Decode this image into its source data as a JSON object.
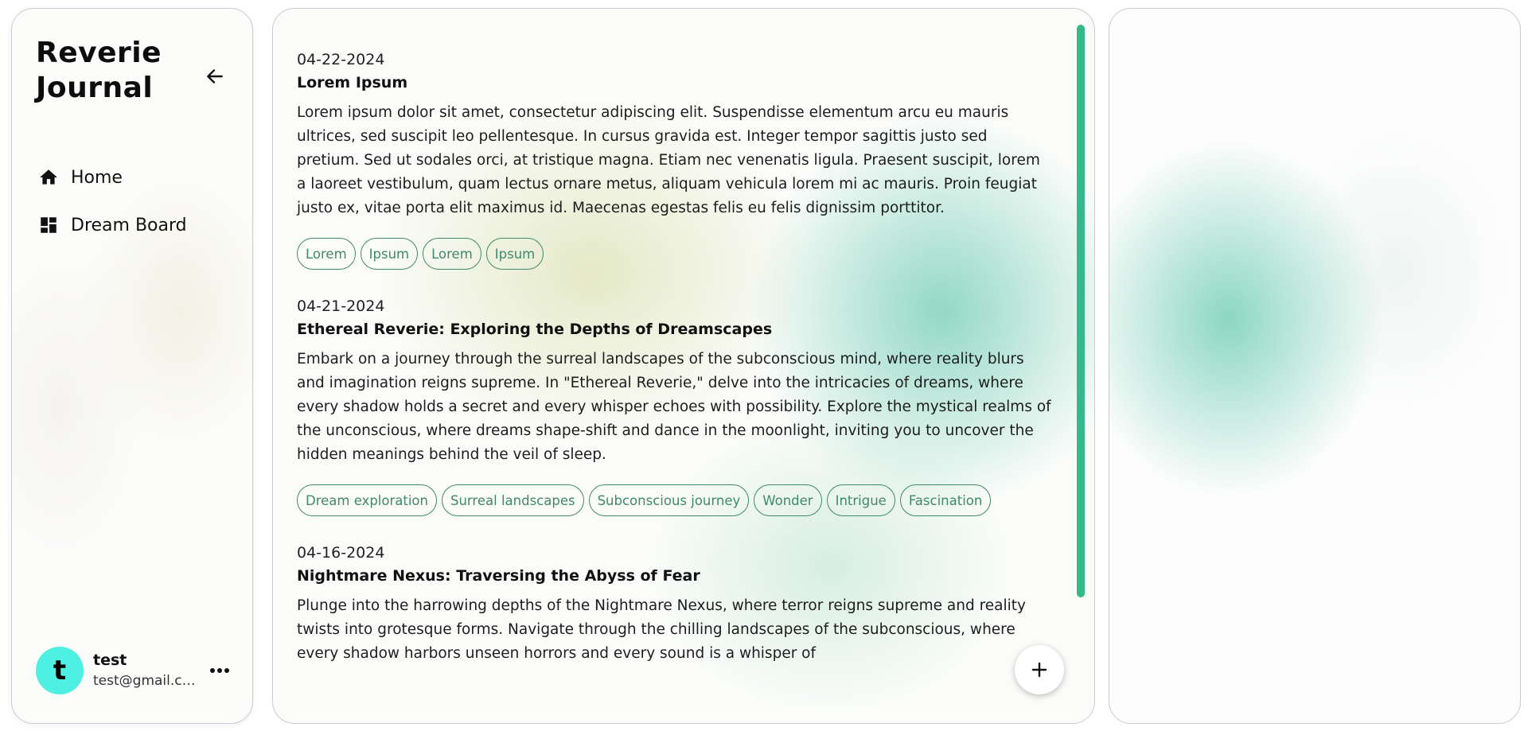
{
  "sidebar": {
    "brand": "Reverie Journal",
    "nav": [
      {
        "label": "Home",
        "icon": "home-icon"
      },
      {
        "label": "Dream Board",
        "icon": "dashboard-icon"
      }
    ],
    "user": {
      "initial": "t",
      "name": "test",
      "email": "test@gmail.com",
      "avatar_color": "#4ef0e4"
    }
  },
  "entries": [
    {
      "date": "04-22-2024",
      "title": "Lorem Ipsum",
      "body": "Lorem ipsum dolor sit amet, consectetur adipiscing elit. Suspendisse elementum arcu eu mauris ultrices, sed suscipit leo pellentesque. In cursus gravida est. Integer tempor sagittis justo sed pretium. Sed ut sodales orci, at tristique magna. Etiam nec venenatis ligula. Praesent suscipit, lorem a laoreet vestibulum, quam lectus ornare metus, aliquam vehicula lorem mi ac mauris. Proin feugiat justo ex, vitae porta elit maximus id. Maecenas egestas felis eu felis dignissim porttitor.",
      "tags": [
        "Lorem",
        "Ipsum",
        "Lorem",
        "Ipsum"
      ]
    },
    {
      "date": "04-21-2024",
      "title": "Ethereal Reverie: Exploring the Depths of Dreamscapes",
      "body": "Embark on a journey through the surreal landscapes of the subconscious mind, where reality blurs and imagination reigns supreme. In \"Ethereal Reverie,\" delve into the intricacies of dreams, where every shadow holds a secret and every whisper echoes with possibility. Explore the mystical realms of the unconscious, where dreams shape-shift and dance in the moonlight, inviting you to uncover the hidden meanings behind the veil of sleep.",
      "tags": [
        "Dream exploration",
        "Surreal landscapes",
        "Subconscious journey",
        "Wonder",
        "Intrigue",
        "Fascination"
      ]
    },
    {
      "date": "04-16-2024",
      "title": "Nightmare Nexus: Traversing the Abyss of Fear",
      "body": "Plunge into the harrowing depths of the Nightmare Nexus, where terror reigns supreme and reality twists into grotesque forms. Navigate through the chilling landscapes of the subconscious, where every shadow harbors unseen horrors and every sound is a whisper of",
      "tags": []
    }
  ],
  "colors": {
    "accent": "#36b98a",
    "tag": "#3f8a6b"
  }
}
